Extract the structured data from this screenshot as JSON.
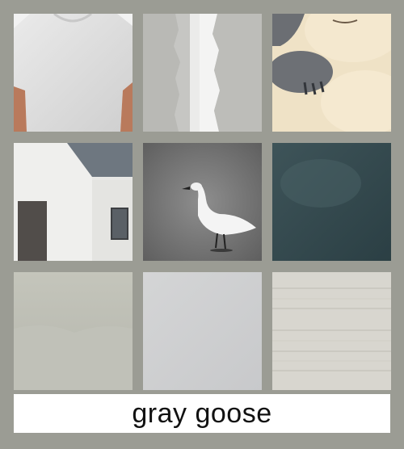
{
  "caption": {
    "text": "gray goose"
  },
  "tiles": [
    {
      "subject": "gray-tshirt"
    },
    {
      "subject": "torn-paper-strips"
    },
    {
      "subject": "cartoon-creature"
    },
    {
      "subject": "white-house"
    },
    {
      "subject": "goose"
    },
    {
      "subject": "dark-teal-texture"
    },
    {
      "subject": "gray-gradient"
    },
    {
      "subject": "light-gray-panel"
    },
    {
      "subject": "wood-texture"
    }
  ],
  "colors": {
    "background": "#9b9c94",
    "caption_bg": "#ffffff",
    "caption_text": "#111111"
  }
}
